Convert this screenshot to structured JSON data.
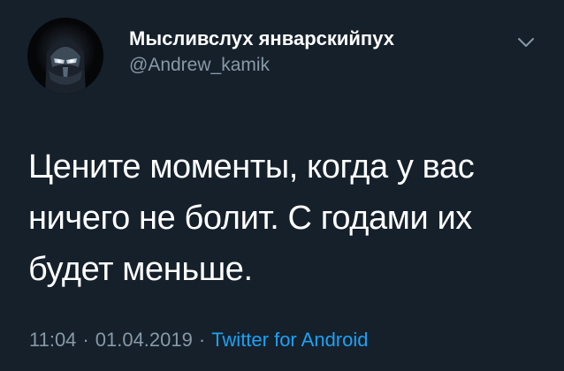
{
  "author": {
    "display_name": "Мысливслух январскийпух",
    "handle": "@Andrew_kamik"
  },
  "tweet": {
    "lines": [
      "Цените моменты, когда у вас",
      "ничего не болит. С годами их",
      "будет меньше."
    ],
    "time": "11:04",
    "date": "01.04.2019",
    "separator": "·",
    "source": "Twitter for Android"
  },
  "icons": {
    "menu": "chevron-down-icon",
    "avatar": "masked-figure-avatar"
  },
  "colors": {
    "background": "#15202b",
    "primary_text": "#ffffff",
    "secondary_text": "#8899a6",
    "link": "#1da1f2"
  }
}
